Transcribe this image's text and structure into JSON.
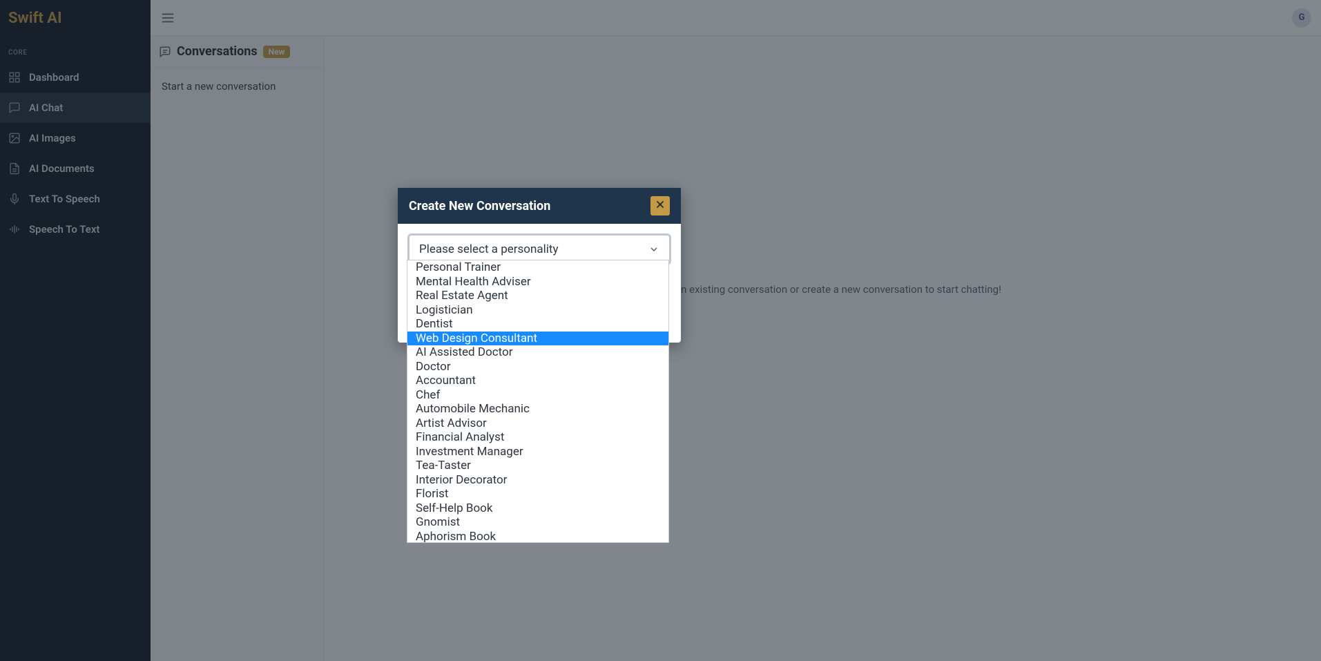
{
  "app": {
    "brand": "Swift AI"
  },
  "avatar": {
    "initial": "G"
  },
  "sidebar": {
    "section_label": "CORE",
    "items": [
      {
        "label": "Dashboard",
        "icon": "grid-icon",
        "active": false
      },
      {
        "label": "AI Chat",
        "icon": "chat-icon",
        "active": true
      },
      {
        "label": "AI Images",
        "icon": "image-icon",
        "active": false
      },
      {
        "label": "AI Documents",
        "icon": "file-icon",
        "active": false
      },
      {
        "label": "Text To Speech",
        "icon": "mic-icon",
        "active": false
      },
      {
        "label": "Speech To Text",
        "icon": "wave-icon",
        "active": false
      }
    ]
  },
  "conv_panel": {
    "title": "Conversations",
    "badge": "New",
    "start_label": "Start a new conversation"
  },
  "chat": {
    "empty_hint": "Select an existing conversation or create a new conversation to start chatting!"
  },
  "modal": {
    "title": "Create New Conversation",
    "select": {
      "placeholder": "Please select a personality",
      "options": [
        "Personal Trainer",
        "Mental Health Adviser",
        "Real Estate Agent",
        "Logistician",
        "Dentist",
        "Web Design Consultant",
        "AI Assisted Doctor",
        "Doctor",
        "Accountant",
        "Chef",
        "Automobile Mechanic",
        "Artist Advisor",
        "Financial Analyst",
        "Investment Manager",
        "Tea-Taster",
        "Interior Decorator",
        "Florist",
        "Self-Help Book",
        "Gnomist",
        "Aphorism Book"
      ],
      "highlighted_index": 5
    }
  }
}
